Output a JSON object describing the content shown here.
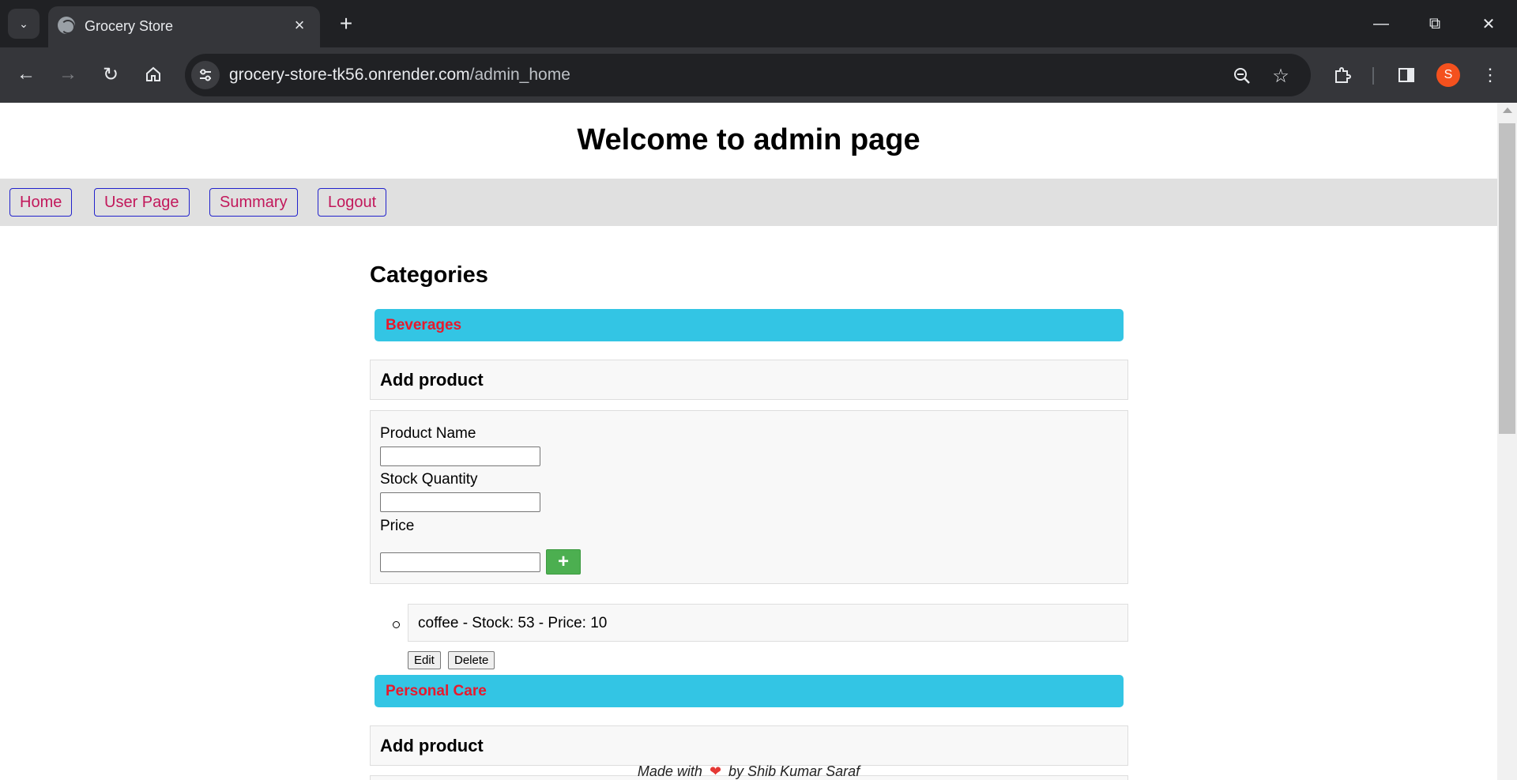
{
  "browser": {
    "tab_title": "Grocery Store",
    "url_host": "grocery-store-tk56.onrender.com",
    "url_path": "/admin_home",
    "profile_initial": "S",
    "icons": {
      "tab_search": "chevron-down-icon",
      "favicon": "globe-icon",
      "tab_close": "close-icon",
      "new_tab": "plus-icon",
      "back": "arrow-left-icon",
      "forward": "arrow-right-icon",
      "reload": "reload-icon",
      "home": "home-icon",
      "site_info": "tune-icon",
      "zoom": "zoom-out-icon",
      "bookmark": "star-icon",
      "extensions": "puzzle-icon",
      "side_panel": "side-panel-icon",
      "menu": "kebab-menu-icon"
    }
  },
  "page": {
    "title": "Welcome to admin page",
    "nav": [
      {
        "label": "Home"
      },
      {
        "label": "User Page"
      },
      {
        "label": "Summary"
      },
      {
        "label": "Logout"
      }
    ],
    "categories_heading": "Categories",
    "categories": [
      {
        "name": "Beverages",
        "add_product": {
          "heading": "Add product",
          "fields": [
            {
              "label": "Product Name",
              "value": ""
            },
            {
              "label": "Stock Quantity",
              "value": ""
            },
            {
              "label": "Price",
              "value": ""
            }
          ],
          "submit_label": "+"
        },
        "products": [
          {
            "text": "coffee - Stock: 53 - Price: 10",
            "edit_label": "Edit",
            "delete_label": "Delete"
          }
        ]
      },
      {
        "name": "Personal Care",
        "add_product": {
          "heading": "Add product"
        }
      }
    ],
    "footer": {
      "prefix": "Made with",
      "heart": "❤",
      "suffix": "by Shib Kumar Saraf"
    }
  },
  "colors": {
    "category_bar": "#33c5e4",
    "category_text": "#e8192c",
    "nav_text": "#c2185b",
    "nav_border": "#2222cc",
    "add_button": "#4caf50"
  }
}
